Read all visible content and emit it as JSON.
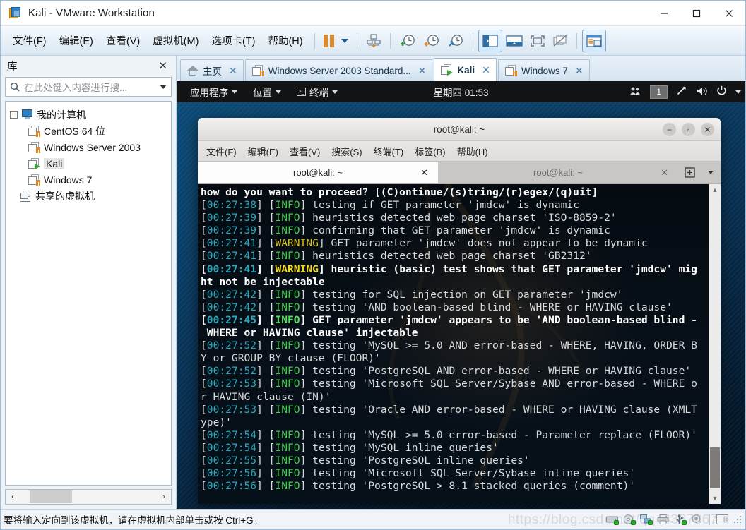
{
  "window": {
    "title": "Kali - VMware Workstation",
    "app_icon": "vmware-icon",
    "minimize": "—",
    "maximize": "□",
    "close": "✕"
  },
  "menubar": {
    "items": [
      {
        "label": "文件(F)",
        "mnemonic": "F"
      },
      {
        "label": "编辑(E)",
        "mnemonic": "E"
      },
      {
        "label": "查看(V)",
        "mnemonic": "V"
      },
      {
        "label": "虚拟机(M)",
        "mnemonic": "M"
      },
      {
        "label": "选项卡(T)",
        "mnemonic": "T"
      },
      {
        "label": "帮助(H)",
        "mnemonic": "H"
      }
    ],
    "toolbar_icons": [
      "pause-icon",
      "dropdown-caret-icon",
      "send-ctrl-alt-del-icon",
      "snapshot-take-icon",
      "snapshot-revert-icon",
      "snapshot-manager-icon",
      "show-library-icon",
      "show-thumbnail-bar-icon",
      "fullscreen-icon",
      "unity-mode-icon",
      "console-view-icon"
    ]
  },
  "library": {
    "title": "库",
    "close_label": "✕",
    "search": {
      "placeholder": "在此处键入内容进行搜...",
      "value": "",
      "icon": "search-icon",
      "caret": "chevron-down-icon"
    },
    "tree": [
      {
        "label": "我的计算机",
        "icon": "computer-icon",
        "level": 0,
        "expander": "−",
        "selected": false
      },
      {
        "label": "CentOS 64 位",
        "icon": "vm-suspended-icon",
        "level": 1,
        "selected": false
      },
      {
        "label": "Windows Server 2003",
        "icon": "vm-suspended-icon",
        "level": 1,
        "selected": false
      },
      {
        "label": "Kali",
        "icon": "vm-running-icon",
        "level": 1,
        "selected": true
      },
      {
        "label": "Windows 7",
        "icon": "vm-suspended-icon",
        "level": 1,
        "selected": false
      },
      {
        "label": "共享的虚拟机",
        "icon": "shared-vms-icon",
        "level": 0,
        "selected": false
      }
    ],
    "hscroll": {
      "left": "‹",
      "right": "›"
    }
  },
  "tabstrip": {
    "tabs": [
      {
        "label": "主页",
        "icon": "home-icon",
        "active": false,
        "close": "✕"
      },
      {
        "label": "Windows Server 2003 Standard...",
        "icon": "vm-suspended-icon",
        "active": false,
        "close": "✕"
      },
      {
        "label": "Kali",
        "icon": "vm-running-icon",
        "active": true,
        "close": "✕"
      },
      {
        "label": "Windows 7",
        "icon": "vm-suspended-icon",
        "active": false,
        "close": "✕"
      }
    ]
  },
  "guest_panel": {
    "applications": "应用程序",
    "places": "位置",
    "terminal": "终端",
    "clock": "星期四 01:53",
    "workspace": "1",
    "tray_icons": [
      "users-icon",
      "workspace-switcher-icon",
      "brightness-icon",
      "volume-icon",
      "power-icon",
      "chevron-down-icon"
    ]
  },
  "terminal_window": {
    "title": "root@kali: ~",
    "controls": {
      "minimize": "−",
      "maximize": "▫",
      "close": "✕"
    },
    "menu": [
      "文件(F)",
      "编辑(E)",
      "查看(V)",
      "搜索(S)",
      "终端(T)",
      "标签(B)",
      "帮助(H)"
    ],
    "tabs": [
      {
        "label": "root@kali: ~",
        "active": true,
        "close": "✕"
      },
      {
        "label": "root@kali: ~",
        "active": false,
        "close": "✕"
      }
    ],
    "new_tab_icon": "new-tab-icon",
    "tab_list_icon": "chevron-down-icon",
    "scrollbar": {
      "up": "▲",
      "down": "▼"
    },
    "lines": [
      {
        "bold": true,
        "parts": [
          {
            "t": "how do you want to proceed? [(C)ontinue/(s)tring/(r)egex/(q)uit]",
            "c": "w"
          }
        ]
      },
      {
        "bold": false,
        "parts": [
          {
            "t": "[",
            "c": "w"
          },
          {
            "t": "00:27:38",
            "c": "ts"
          },
          {
            "t": "] [",
            "c": "w"
          },
          {
            "t": "INFO",
            "c": "inf"
          },
          {
            "t": "] testing if GET parameter 'jmdcw' is dynamic",
            "c": "w"
          }
        ]
      },
      {
        "bold": false,
        "parts": [
          {
            "t": "[",
            "c": "w"
          },
          {
            "t": "00:27:39",
            "c": "ts"
          },
          {
            "t": "] [",
            "c": "w"
          },
          {
            "t": "INFO",
            "c": "inf"
          },
          {
            "t": "] heuristics detected web page charset 'ISO-8859-2'",
            "c": "w"
          }
        ]
      },
      {
        "bold": false,
        "parts": [
          {
            "t": "[",
            "c": "w"
          },
          {
            "t": "00:27:39",
            "c": "ts"
          },
          {
            "t": "] [",
            "c": "w"
          },
          {
            "t": "INFO",
            "c": "inf"
          },
          {
            "t": "] confirming that GET parameter 'jmdcw' is dynamic",
            "c": "w"
          }
        ]
      },
      {
        "bold": false,
        "parts": [
          {
            "t": "[",
            "c": "w"
          },
          {
            "t": "00:27:41",
            "c": "ts"
          },
          {
            "t": "] [",
            "c": "w"
          },
          {
            "t": "WARNING",
            "c": "warn"
          },
          {
            "t": "] GET parameter 'jmdcw' does not appear to be dynamic",
            "c": "w"
          }
        ]
      },
      {
        "bold": false,
        "parts": [
          {
            "t": "[",
            "c": "w"
          },
          {
            "t": "00:27:41",
            "c": "ts"
          },
          {
            "t": "] [",
            "c": "w"
          },
          {
            "t": "INFO",
            "c": "inf"
          },
          {
            "t": "] heuristics detected web page charset 'GB2312'",
            "c": "w"
          }
        ]
      },
      {
        "bold": true,
        "parts": [
          {
            "t": "[",
            "c": "w"
          },
          {
            "t": "00:27:41",
            "c": "ts"
          },
          {
            "t": "] [",
            "c": "w"
          },
          {
            "t": "WARNING",
            "c": "warn"
          },
          {
            "t": "] heuristic (basic) test shows that GET parameter 'jmdcw' mig",
            "c": "w"
          }
        ]
      },
      {
        "bold": true,
        "parts": [
          {
            "t": "ht not be injectable",
            "c": "w"
          }
        ]
      },
      {
        "bold": false,
        "parts": [
          {
            "t": "[",
            "c": "w"
          },
          {
            "t": "00:27:42",
            "c": "ts"
          },
          {
            "t": "] [",
            "c": "w"
          },
          {
            "t": "INFO",
            "c": "inf"
          },
          {
            "t": "] testing for SQL injection on GET parameter 'jmdcw'",
            "c": "w"
          }
        ]
      },
      {
        "bold": false,
        "parts": [
          {
            "t": "[",
            "c": "w"
          },
          {
            "t": "00:27:42",
            "c": "ts"
          },
          {
            "t": "] [",
            "c": "w"
          },
          {
            "t": "INFO",
            "c": "inf"
          },
          {
            "t": "] testing 'AND boolean-based blind - WHERE or HAVING clause'",
            "c": "w"
          }
        ]
      },
      {
        "bold": true,
        "parts": [
          {
            "t": "[",
            "c": "w"
          },
          {
            "t": "00:27:45",
            "c": "ts"
          },
          {
            "t": "] [",
            "c": "w"
          },
          {
            "t": "INFO",
            "c": "inf"
          },
          {
            "t": "] GET parameter 'jmdcw' appears to be 'AND boolean-based blind -",
            "c": "w"
          }
        ]
      },
      {
        "bold": true,
        "parts": [
          {
            "t": " WHERE or HAVING clause' injectable",
            "c": "w"
          }
        ]
      },
      {
        "bold": false,
        "parts": [
          {
            "t": "[",
            "c": "w"
          },
          {
            "t": "00:27:52",
            "c": "ts"
          },
          {
            "t": "] [",
            "c": "w"
          },
          {
            "t": "INFO",
            "c": "inf"
          },
          {
            "t": "] testing 'MySQL >= 5.0 AND error-based - WHERE, HAVING, ORDER B",
            "c": "w"
          }
        ]
      },
      {
        "bold": false,
        "parts": [
          {
            "t": "Y or GROUP BY clause (FLOOR)'",
            "c": "w"
          }
        ]
      },
      {
        "bold": false,
        "parts": [
          {
            "t": "[",
            "c": "w"
          },
          {
            "t": "00:27:52",
            "c": "ts"
          },
          {
            "t": "] [",
            "c": "w"
          },
          {
            "t": "INFO",
            "c": "inf"
          },
          {
            "t": "] testing 'PostgreSQL AND error-based - WHERE or HAVING clause'",
            "c": "w"
          }
        ]
      },
      {
        "bold": false,
        "parts": [
          {
            "t": "[",
            "c": "w"
          },
          {
            "t": "00:27:53",
            "c": "ts"
          },
          {
            "t": "] [",
            "c": "w"
          },
          {
            "t": "INFO",
            "c": "inf"
          },
          {
            "t": "] testing 'Microsoft SQL Server/Sybase AND error-based - WHERE o",
            "c": "w"
          }
        ]
      },
      {
        "bold": false,
        "parts": [
          {
            "t": "r HAVING clause (IN)'",
            "c": "w"
          }
        ]
      },
      {
        "bold": false,
        "parts": [
          {
            "t": "[",
            "c": "w"
          },
          {
            "t": "00:27:53",
            "c": "ts"
          },
          {
            "t": "] [",
            "c": "w"
          },
          {
            "t": "INFO",
            "c": "inf"
          },
          {
            "t": "] testing 'Oracle AND error-based - WHERE or HAVING clause (XMLT",
            "c": "w"
          }
        ]
      },
      {
        "bold": false,
        "parts": [
          {
            "t": "ype)'",
            "c": "w"
          }
        ]
      },
      {
        "bold": false,
        "parts": [
          {
            "t": "[",
            "c": "w"
          },
          {
            "t": "00:27:54",
            "c": "ts"
          },
          {
            "t": "] [",
            "c": "w"
          },
          {
            "t": "INFO",
            "c": "inf"
          },
          {
            "t": "] testing 'MySQL >= 5.0 error-based - Parameter replace (FLOOR)'",
            "c": "w"
          }
        ]
      },
      {
        "bold": false,
        "parts": [
          {
            "t": "[",
            "c": "w"
          },
          {
            "t": "00:27:54",
            "c": "ts"
          },
          {
            "t": "] [",
            "c": "w"
          },
          {
            "t": "INFO",
            "c": "inf"
          },
          {
            "t": "] testing 'MySQL inline queries'",
            "c": "w"
          }
        ]
      },
      {
        "bold": false,
        "parts": [
          {
            "t": "[",
            "c": "w"
          },
          {
            "t": "00:27:55",
            "c": "ts"
          },
          {
            "t": "] [",
            "c": "w"
          },
          {
            "t": "INFO",
            "c": "inf"
          },
          {
            "t": "] testing 'PostgreSQL inline queries'",
            "c": "w"
          }
        ]
      },
      {
        "bold": false,
        "parts": [
          {
            "t": "[",
            "c": "w"
          },
          {
            "t": "00:27:56",
            "c": "ts"
          },
          {
            "t": "] [",
            "c": "w"
          },
          {
            "t": "INFO",
            "c": "inf"
          },
          {
            "t": "] testing 'Microsoft SQL Server/Sybase inline queries'",
            "c": "w"
          }
        ]
      },
      {
        "bold": false,
        "parts": [
          {
            "t": "[",
            "c": "w"
          },
          {
            "t": "00:27:56",
            "c": "ts"
          },
          {
            "t": "] [",
            "c": "w"
          },
          {
            "t": "INFO",
            "c": "inf"
          },
          {
            "t": "] testing 'PostgreSQL > 8.1 stacked queries (comment)'",
            "c": "w"
          }
        ]
      }
    ]
  },
  "statusbar": {
    "message": "要将输入定向到该虚拟机，请在虚拟机内部单击或按 Ctrl+G。",
    "watermark": "https://blog.csdn.net/qq_43678676",
    "icons": [
      "harddisk-icon",
      "cdrom-icon",
      "network-icon",
      "printer-icon",
      "usb-icon",
      "camera-icon",
      "sidebar-toggle-icon",
      "resize-grip-icon"
    ]
  },
  "colors": {
    "accent": "#2a7fc9",
    "timestamp": "#2aa8bd",
    "info": "#44c94f",
    "warning": "#d6c015",
    "terminal_bg": "#060d14",
    "kali_bg": "#052c4a"
  }
}
